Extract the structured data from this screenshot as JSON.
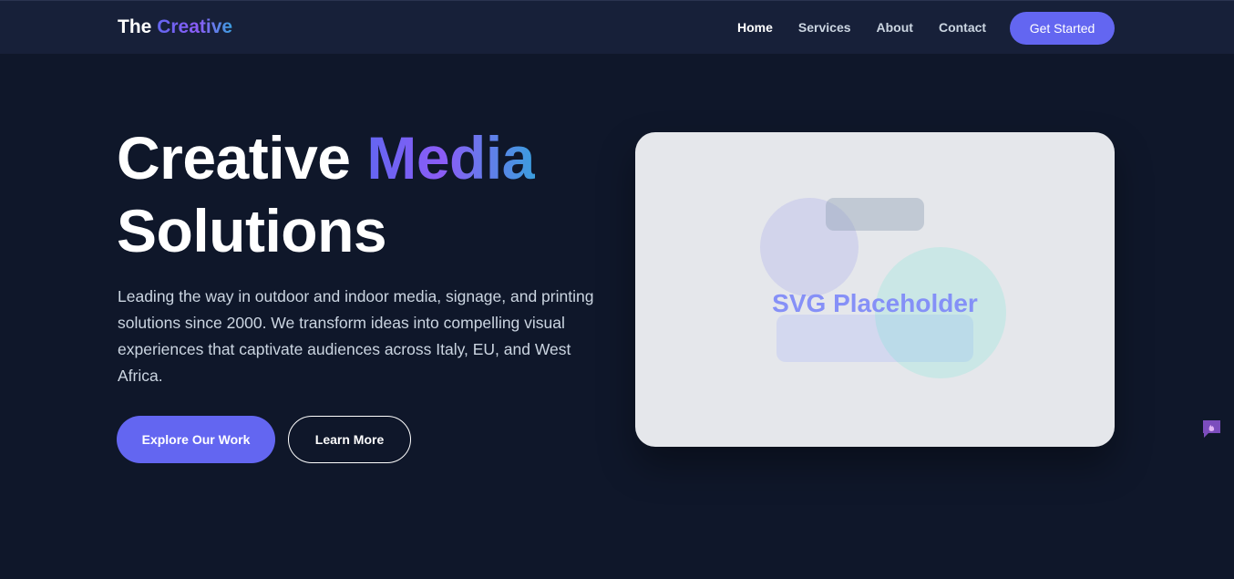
{
  "navbar": {
    "brand_prefix": "The",
    "brand_accent": "Creative",
    "links": [
      {
        "label": "Home",
        "active": true
      },
      {
        "label": "Services",
        "active": false
      },
      {
        "label": "About",
        "active": false
      },
      {
        "label": "Contact",
        "active": false
      }
    ],
    "cta_label": "Get Started"
  },
  "hero": {
    "title_part1": "Creative",
    "title_accent": "Media",
    "title_part2": "Solutions",
    "description": "Leading the way in outdoor and indoor media, signage, and printing solutions since 2000. We transform ideas into compelling visual experiences that captivate audiences across Italy, EU, and West Africa.",
    "primary_button": "Explore Our Work",
    "secondary_button": "Learn More",
    "image_placeholder_label": "SVG Placeholder"
  },
  "colors": {
    "background": "#0f172a",
    "navbar": "#172039",
    "accent": "#6366f1",
    "accent_purple": "#8b5cf6",
    "accent_blue": "#3b9ede",
    "card": "#e5e7eb"
  },
  "icons": {
    "chat_widget": "chat-bubble-icon"
  }
}
